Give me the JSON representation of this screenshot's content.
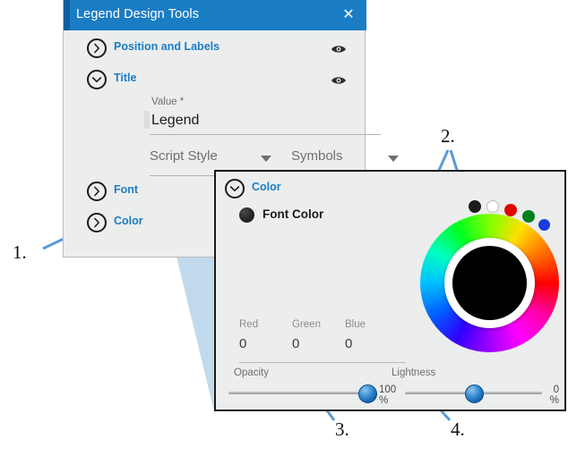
{
  "legend_panel": {
    "title": "Legend Design Tools",
    "close_icon": "close-icon",
    "sections": [
      {
        "label": "Position and Labels",
        "state": "collapsed",
        "visibility_icon": "eye-icon"
      },
      {
        "label": "Title",
        "state": "expanded",
        "visibility_icon": "eye-icon"
      }
    ],
    "value_field": {
      "label": "Value *",
      "value": "Legend"
    },
    "dropdowns": [
      {
        "label": "Script Style",
        "icon": "chevron-down-icon"
      },
      {
        "label": "Symbols",
        "icon": "chevron-down-icon"
      }
    ],
    "bottom_sections": [
      {
        "label": "Font",
        "state": "collapsed"
      },
      {
        "label": "Color",
        "state": "collapsed"
      }
    ]
  },
  "color_panel": {
    "header": {
      "label": "Color",
      "state": "expanded"
    },
    "font_color": {
      "label": "Font Color",
      "swatch": "#141414"
    },
    "rgb": [
      {
        "label": "Red",
        "value": "0"
      },
      {
        "label": "Green",
        "value": "0"
      },
      {
        "label": "Blue",
        "value": "0"
      }
    ],
    "opacity": {
      "label": "Opacity",
      "thumb_pct": 88
    },
    "lightness": {
      "label": "Lightness",
      "left_value": "100",
      "left_unit": "%",
      "right_value": "0",
      "right_unit": "%",
      "thumb_pct": 50
    },
    "wheel": {
      "name": "color-wheel",
      "selected_color": "#000000"
    },
    "presets": [
      {
        "name": "preset-black",
        "color": "#1b1b1b"
      },
      {
        "name": "preset-white",
        "color": "#ffffff"
      },
      {
        "name": "preset-red",
        "color": "#e00000"
      },
      {
        "name": "preset-green",
        "color": "#00801f"
      },
      {
        "name": "preset-blue",
        "color": "#1b3ddd"
      }
    ]
  },
  "callouts": [
    {
      "number": "1."
    },
    {
      "number": "2."
    },
    {
      "number": "3."
    },
    {
      "number": "4."
    }
  ],
  "colors": {
    "accent_blue": "#1a7dc4",
    "titlebar_blue": "#1a7dc4",
    "panel_gray": "#eceded",
    "callout_line": "#5a9bd5"
  }
}
